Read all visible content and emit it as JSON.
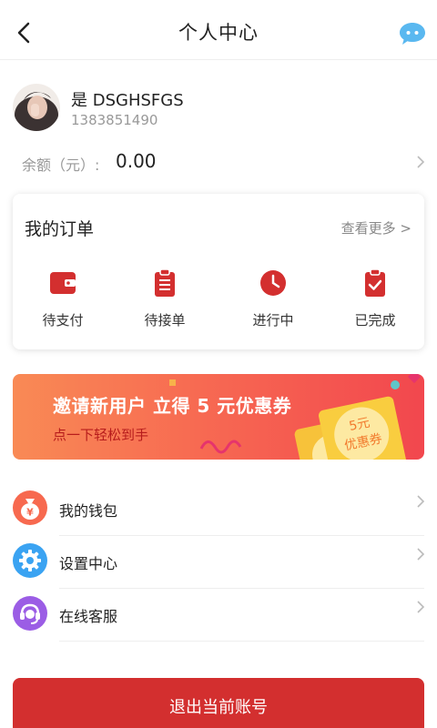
{
  "header": {
    "title": "个人中心"
  },
  "user": {
    "name": "是 DSGHSFGS",
    "phone": "1383851490"
  },
  "balance": {
    "label": "余额（元）:",
    "value": "0.00"
  },
  "orders": {
    "title": "我的订单",
    "more_label": "查看更多 >",
    "items": [
      {
        "label": "待支付",
        "icon": "wallet-icon"
      },
      {
        "label": "待接单",
        "icon": "clipboard-list-icon"
      },
      {
        "label": "进行中",
        "icon": "clock-icon"
      },
      {
        "label": "已完成",
        "icon": "clipboard-check-icon"
      }
    ]
  },
  "banner": {
    "title": "邀请新用户 立得 5 元优惠券",
    "subtitle": "点一下轻松到手",
    "coupon_text_1": "5元",
    "coupon_text_2": "优惠券"
  },
  "menu": [
    {
      "label": "我的钱包",
      "icon": "money-bag-icon",
      "color": "#f7694f"
    },
    {
      "label": "设置中心",
      "icon": "gear-icon",
      "color": "#3aa3f2"
    },
    {
      "label": "在线客服",
      "icon": "headset-icon",
      "color": "#9b5de5"
    }
  ],
  "logout": {
    "label": "退出当前账号"
  },
  "colors": {
    "accent": "#d32f2f",
    "chat": "#5ab8f0"
  }
}
